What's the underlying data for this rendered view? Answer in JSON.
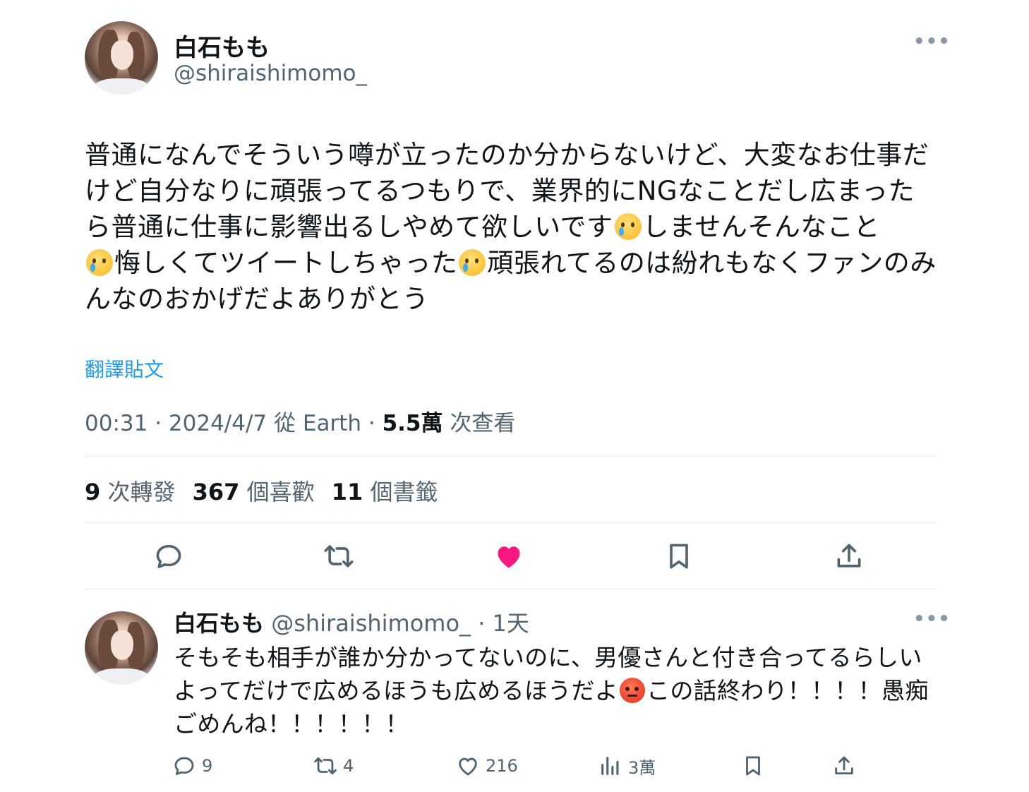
{
  "tweet": {
    "author_name": "白石もも",
    "author_handle": "@shiraishimomo_",
    "more_label": "•••",
    "text_segments": [
      "普通になんでそういう噂が立ったのか分からないけど、大変なお仕事だけど自分なりに頑張ってるつもりで、業界的にNGなことだし広まったら普通に仕事に影響出るしやめて欲しいです",
      "しませんそんなこと",
      "悔しくてツイートしちゃった",
      "頑張れてるのは紛れもなくファンのみんなのおかげだよありがとう"
    ],
    "emoji_names": [
      "crying-face-icon",
      "crying-face-icon",
      "crying-face-icon"
    ],
    "translate_label": "翻譯貼文",
    "time": "00:31",
    "date": "2024/4/7",
    "source": "從 Earth",
    "views_count": "5.5萬",
    "views_label": "次查看",
    "stats": {
      "retweets_count": "9",
      "retweets_label": "次轉發",
      "likes_count": "367",
      "likes_label": "個喜歡",
      "bookmarks_count": "11",
      "bookmarks_label": "個書籤"
    },
    "actions": [
      "reply-icon",
      "retweet-icon",
      "like-icon",
      "bookmark-icon",
      "share-icon"
    ],
    "colors": {
      "like_active": "#f91880",
      "link": "#1d9bf0",
      "secondary_text": "#536471"
    }
  },
  "reply": {
    "author_name": "白石もも",
    "author_handle": "@shiraishimomo_",
    "time_ago": "1天",
    "more_label": "•••",
    "text_before_emoji": "そもそも相手が誰か分かってないのに、男優さんと付き合ってるらしいよってだけで広めるほうも広めるほうだよ",
    "emoji_name": "angry-face-icon",
    "text_after_emoji": "この話終わり！！！！愚痴ごめんね！！！！！！",
    "reply_count": "9",
    "retweet_count": "4",
    "like_count": "216",
    "view_count": "3萬"
  }
}
